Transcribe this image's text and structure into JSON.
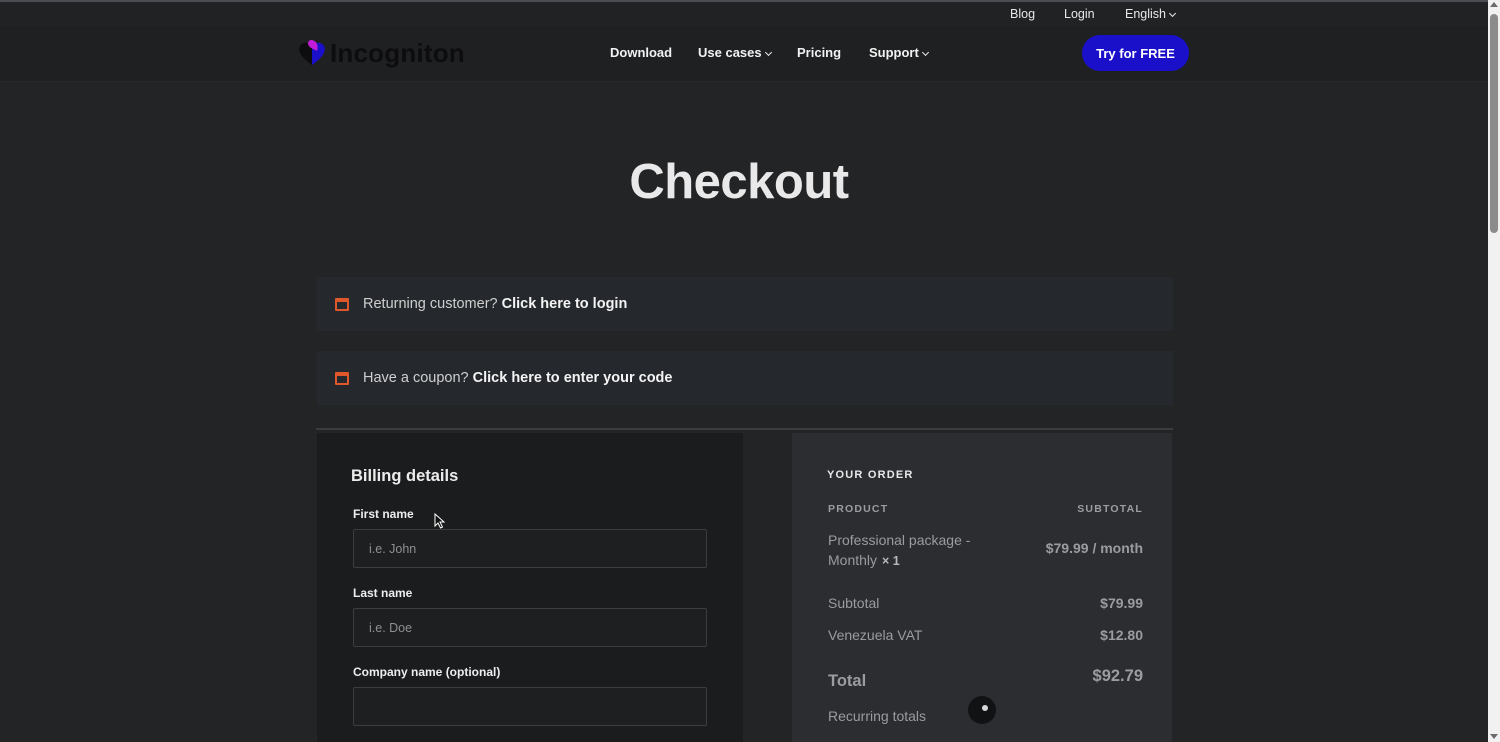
{
  "topbar": {
    "blog": "Blog",
    "login": "Login",
    "language": "English"
  },
  "header": {
    "logo_text": "Incogniton",
    "nav": {
      "download": "Download",
      "use_cases": "Use cases",
      "pricing": "Pricing",
      "support": "Support"
    },
    "cta": "Try for FREE"
  },
  "page": {
    "title": "Checkout"
  },
  "notices": {
    "login": {
      "text": "Returning customer?",
      "link": "Click here to login"
    },
    "coupon": {
      "text": "Have a coupon?",
      "link": "Click here to enter your code"
    }
  },
  "billing": {
    "title": "Billing details",
    "first_name": {
      "label": "First name",
      "placeholder": "i.e. John"
    },
    "last_name": {
      "label": "Last name",
      "placeholder": "i.e. Doe"
    },
    "company": {
      "label": "Company name (optional)",
      "placeholder": ""
    }
  },
  "order": {
    "title": "YOUR ORDER",
    "col_product": "PRODUCT",
    "col_subtotal": "SUBTOTAL",
    "item_name": "Professional package - Monthly",
    "item_qty": "× 1",
    "item_price": "$79.99 / month",
    "subtotal_label": "Subtotal",
    "subtotal_value": "$79.99",
    "vat_label": "Venezuela VAT",
    "vat_value": "$12.80",
    "total_label": "Total",
    "total_value": "$92.79",
    "recurring_label": "Recurring totals"
  },
  "colors": {
    "accent": "#1a10c9",
    "notice_icon": "#e0572b"
  }
}
